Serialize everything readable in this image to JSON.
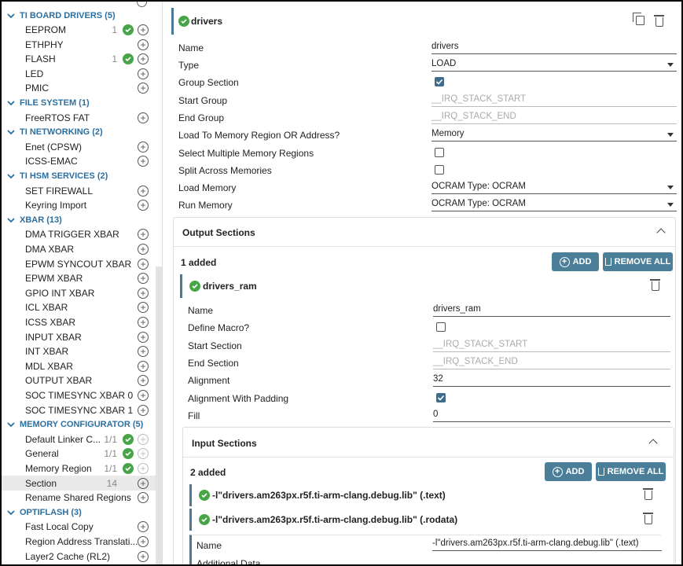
{
  "sidebar": {
    "categories": [
      {
        "label": "TI BOARD DRIVERS (5)"
      },
      {
        "label": "FILE SYSTEM (1)"
      },
      {
        "label": "TI NETWORKING (2)"
      },
      {
        "label": "TI HSM SERVICES (2)"
      },
      {
        "label": "XBAR (13)"
      },
      {
        "label": "MEMORY CONFIGURATOR (5)"
      },
      {
        "label": "OPTIFLASH (3)"
      }
    ],
    "items": [
      {
        "label": "EEPROM",
        "count": "1"
      },
      {
        "label": "ETHPHY",
        "count": ""
      },
      {
        "label": "FLASH",
        "count": "1"
      },
      {
        "label": "LED",
        "count": ""
      },
      {
        "label": "PMIC",
        "count": ""
      },
      {
        "label": "FreeRTOS FAT",
        "count": ""
      },
      {
        "label": "Enet (CPSW)",
        "count": ""
      },
      {
        "label": "ICSS-EMAC",
        "count": ""
      },
      {
        "label": "SET FIREWALL",
        "count": ""
      },
      {
        "label": "Keyring Import",
        "count": ""
      },
      {
        "label": "DMA TRIGGER XBAR",
        "count": ""
      },
      {
        "label": "DMA XBAR",
        "count": ""
      },
      {
        "label": "EPWM SYNCOUT XBAR",
        "count": ""
      },
      {
        "label": "EPWM XBAR",
        "count": ""
      },
      {
        "label": "GPIO INT XBAR",
        "count": ""
      },
      {
        "label": "ICL XBAR",
        "count": ""
      },
      {
        "label": "ICSS XBAR",
        "count": ""
      },
      {
        "label": "INPUT XBAR",
        "count": ""
      },
      {
        "label": "INT XBAR",
        "count": ""
      },
      {
        "label": "MDL XBAR",
        "count": ""
      },
      {
        "label": "OUTPUT XBAR",
        "count": ""
      },
      {
        "label": "SOC TIMESYNC XBAR 0",
        "count": ""
      },
      {
        "label": "SOC TIMESYNC XBAR 1",
        "count": ""
      },
      {
        "label": "Default Linker C...",
        "count": "1/1"
      },
      {
        "label": "General",
        "count": "1/1"
      },
      {
        "label": "Memory Region",
        "count": "1/1"
      },
      {
        "label": "Section",
        "count": "14"
      },
      {
        "label": "Rename Shared Regions",
        "count": ""
      },
      {
        "label": "Fast Local Copy",
        "count": ""
      },
      {
        "label": "Region Address Translati...",
        "count": ""
      },
      {
        "label": "Layer2 Cache (RL2)",
        "count": ""
      }
    ]
  },
  "header": {
    "title": "drivers"
  },
  "form": {
    "name_label": "Name",
    "name_value": "drivers",
    "type_label": "Type",
    "type_value": "LOAD",
    "group_section_label": "Group Section",
    "start_group_label": "Start Group",
    "start_group_placeholder": "__IRQ_STACK_START",
    "end_group_label": "End Group",
    "end_group_placeholder": "__IRQ_STACK_END",
    "load_to_label": "Load To Memory Region OR Address?",
    "load_to_value": "Memory",
    "select_multiple_label": "Select Multiple Memory Regions",
    "split_label": "Split Across Memories",
    "load_memory_label": "Load Memory",
    "load_memory_value": "OCRAM Type: OCRAM",
    "run_memory_label": "Run Memory",
    "run_memory_value": "OCRAM Type: OCRAM"
  },
  "output": {
    "title": "Output Sections",
    "added": "1 added",
    "add_label": "ADD",
    "remove_all_label": "REMOVE ALL",
    "item_title": "drivers_ram",
    "name_label": "Name",
    "name_value": "drivers_ram",
    "define_macro_label": "Define Macro?",
    "start_section_label": "Start Section",
    "start_section_placeholder": "__IRQ_STACK_START",
    "end_section_label": "End Section",
    "end_section_placeholder": "__IRQ_STACK_END",
    "alignment_label": "Alignment",
    "alignment_value": "32",
    "alignment_padding_label": "Alignment With Padding",
    "fill_label": "Fill",
    "fill_value": "0"
  },
  "input": {
    "title": "Input Sections",
    "added": "2 added",
    "add_label": "ADD",
    "remove_all_label": "REMOVE ALL",
    "items": [
      {
        "label": "-l\"drivers.am263px.r5f.ti-arm-clang.debug.lib\" (.text)"
      },
      {
        "label": "-l\"drivers.am263px.r5f.ti-arm-clang.debug.lib\" (.rodata)"
      }
    ],
    "name_label": "Name",
    "name_value": "-l\"drivers.am263px.r5f.ti-arm-clang.debug.lib\" (.text)",
    "additional_data_label": "Additional Data"
  }
}
